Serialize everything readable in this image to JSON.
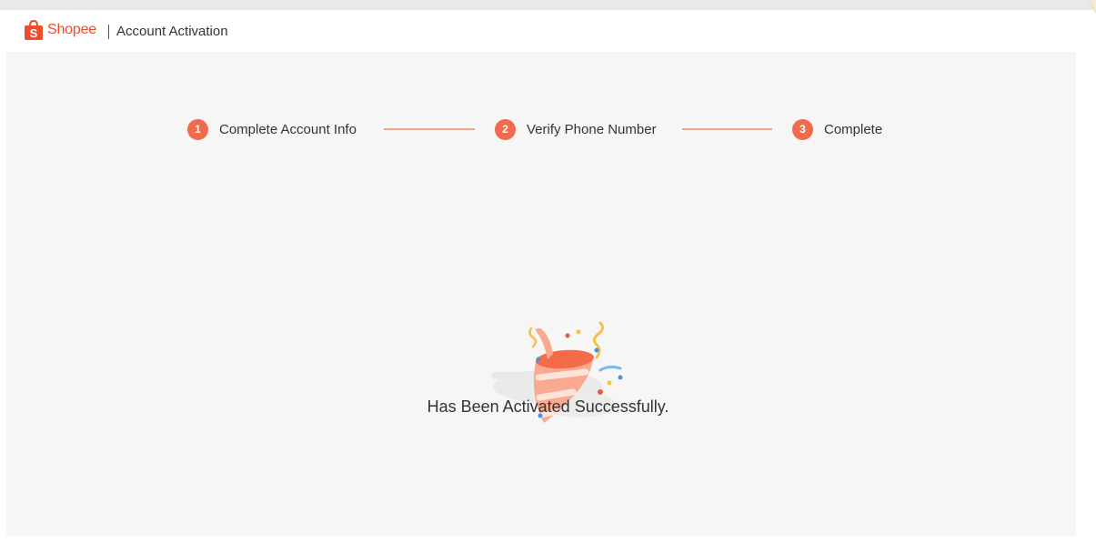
{
  "header": {
    "brand_name": "Shopee",
    "logo_icon": "shopee-bag-icon",
    "page_title": "Account Activation"
  },
  "stepper": {
    "steps": [
      {
        "number": "1",
        "label": "Complete Account Info"
      },
      {
        "number": "2",
        "label": "Verify Phone Number"
      },
      {
        "number": "3",
        "label": "Complete"
      }
    ]
  },
  "result": {
    "illustration_icon": "party-popper-icon",
    "message": "Has Been Activated Successfully."
  },
  "colors": {
    "brand": "#ee4d2d",
    "step_circle": "#ee6b4d",
    "step_line": "#f3a58f",
    "page_background": "#f6f6f6"
  }
}
